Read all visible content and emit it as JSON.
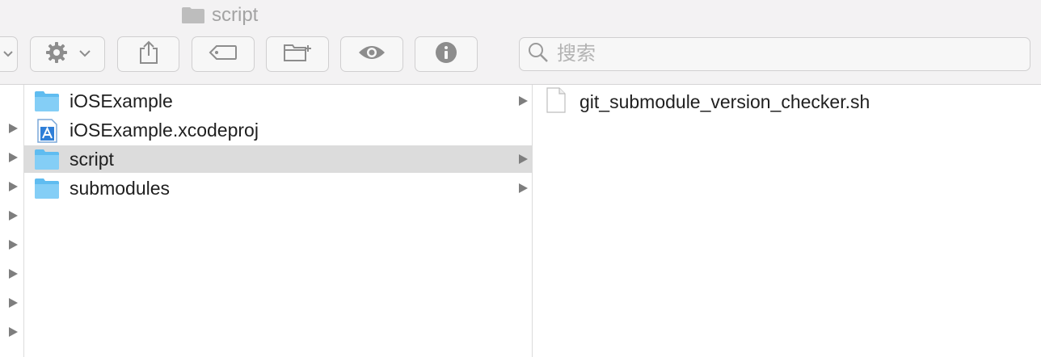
{
  "window": {
    "title": "script"
  },
  "toolbar": {
    "search_placeholder": "搜索",
    "buttons": [
      {
        "name": "view-menu-button",
        "icon": "chevron-down-icon"
      },
      {
        "name": "action-menu-button",
        "icon": "gear-icon"
      },
      {
        "name": "share-button",
        "icon": "share-icon"
      },
      {
        "name": "tag-button",
        "icon": "tag-icon"
      },
      {
        "name": "new-folder-button",
        "icon": "new-folder-icon"
      },
      {
        "name": "quick-look-button",
        "icon": "eye-icon"
      },
      {
        "name": "get-info-button",
        "icon": "info-icon"
      }
    ]
  },
  "columns": {
    "middle": {
      "items": [
        {
          "label": "iOSExample",
          "type": "folder",
          "has_children": true,
          "selected": false
        },
        {
          "label": "iOSExample.xcodeproj",
          "type": "xcodeproj",
          "has_children": false,
          "selected": false
        },
        {
          "label": "script",
          "type": "folder",
          "has_children": true,
          "selected": true
        },
        {
          "label": "submodules",
          "type": "folder",
          "has_children": true,
          "selected": false
        }
      ]
    },
    "right": {
      "items": [
        {
          "label": "git_submodule_version_checker.sh",
          "type": "file"
        }
      ]
    }
  },
  "colors": {
    "folder": "#5fbcf0",
    "selection": "#dcdcdc",
    "toolbar_bg": "#f3f2f3"
  }
}
